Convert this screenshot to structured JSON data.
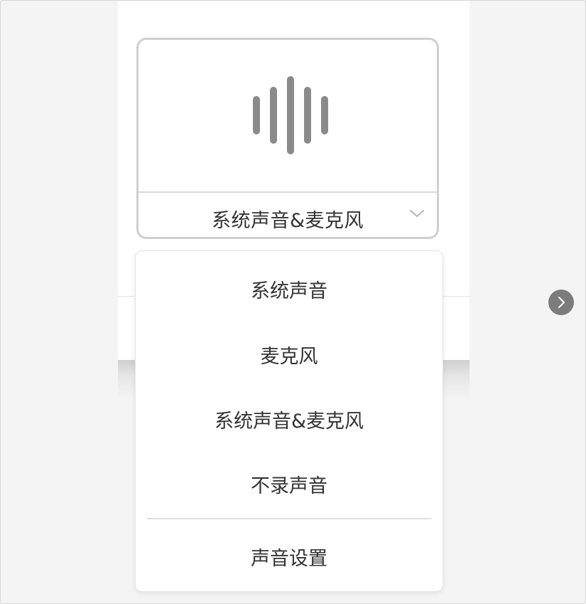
{
  "audio_source": {
    "selected_label": "系统声音&麦克风",
    "icon": "sound-wave-icon",
    "icon_color": "#8a8a8a"
  },
  "menu": {
    "items": [
      {
        "label": "系统声音"
      },
      {
        "label": "麦克风"
      },
      {
        "label": "系统声音&麦克风"
      },
      {
        "label": "不录声音"
      }
    ],
    "settings_label": "声音设置"
  },
  "navigation": {
    "next_icon": "chevron-right-icon"
  }
}
